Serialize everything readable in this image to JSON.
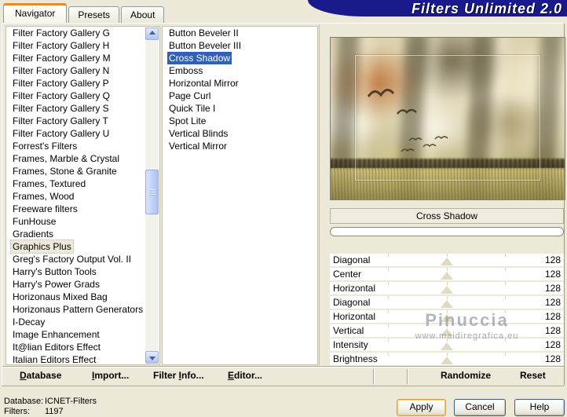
{
  "window": {
    "title": "Filters Unlimited 2.0"
  },
  "tabs": [
    {
      "label": "Navigator",
      "active": true
    },
    {
      "label": "Presets",
      "active": false
    },
    {
      "label": "About",
      "active": false
    }
  ],
  "navigator_list": {
    "selected": "Graphics Plus",
    "items": [
      "Filter Factory Gallery G",
      "Filter Factory Gallery H",
      "Filter Factory Gallery M",
      "Filter Factory Gallery N",
      "Filter Factory Gallery P",
      "Filter Factory Gallery Q",
      "Filter Factory Gallery S",
      "Filter Factory Gallery T",
      "Filter Factory Gallery U",
      "Forrest's Filters",
      "Frames, Marble & Crystal",
      "Frames, Stone & Granite",
      "Frames, Textured",
      "Frames, Wood",
      "Freeware filters",
      "FunHouse",
      "Gradients",
      "Graphics Plus",
      "Greg's Factory Output Vol. II",
      "Harry's Button Tools",
      "Harry's Power Grads",
      "Horizonaus Mixed Bag",
      "Horizonaus Pattern Generators",
      "I-Decay",
      "Image Enhancement",
      "It@lian Editors Effect",
      "Italian Editors Effect"
    ]
  },
  "filter_list": {
    "selected": "Cross Shadow",
    "items": [
      "Button Beveler II",
      "Button Beveler III",
      "Cross Shadow",
      "Emboss",
      "Horizontal Mirror",
      "Page Curl",
      "Quick Tile I",
      "Spot Lite",
      "Vertical Blinds",
      "Vertical Mirror"
    ]
  },
  "preview": {
    "filter_name": "Cross Shadow",
    "progress_percent": 0,
    "watermark_name": "Pinuccia",
    "watermark_url": "www.maidiregrafica.eu"
  },
  "sliders": [
    {
      "label": "Diagonal",
      "value": 128
    },
    {
      "label": "Center",
      "value": 128
    },
    {
      "label": "Horizontal",
      "value": 128
    },
    {
      "label": "Diagonal",
      "value": 128
    },
    {
      "label": "Horizontal",
      "value": 128
    },
    {
      "label": "Vertical",
      "value": 128
    },
    {
      "label": "Intensity",
      "value": 128
    },
    {
      "label": "Brightness",
      "value": 128
    }
  ],
  "toolbar": {
    "database": {
      "pre": "",
      "accel": "D",
      "post": "atabase"
    },
    "import": {
      "pre": "",
      "accel": "I",
      "post": "mport..."
    },
    "filter_info": {
      "pre": "Filter ",
      "accel": "I",
      "post": "nfo..."
    },
    "editor": {
      "pre": "",
      "accel": "E",
      "post": "ditor..."
    },
    "randomize": "Randomize",
    "reset": "Reset"
  },
  "status": {
    "database_label": "Database:",
    "database_value": "ICNET-Filters",
    "filters_label": "Filters:",
    "filters_value": "1197"
  },
  "buttons": {
    "apply": "Apply",
    "cancel": "Cancel",
    "help": "Help"
  },
  "colors": {
    "banner_navy": "#1A1A8C",
    "selection_blue": "#2F62B5",
    "tab_accent_orange": "#E68B2C",
    "dialog_beige": "#ECE9D8"
  }
}
